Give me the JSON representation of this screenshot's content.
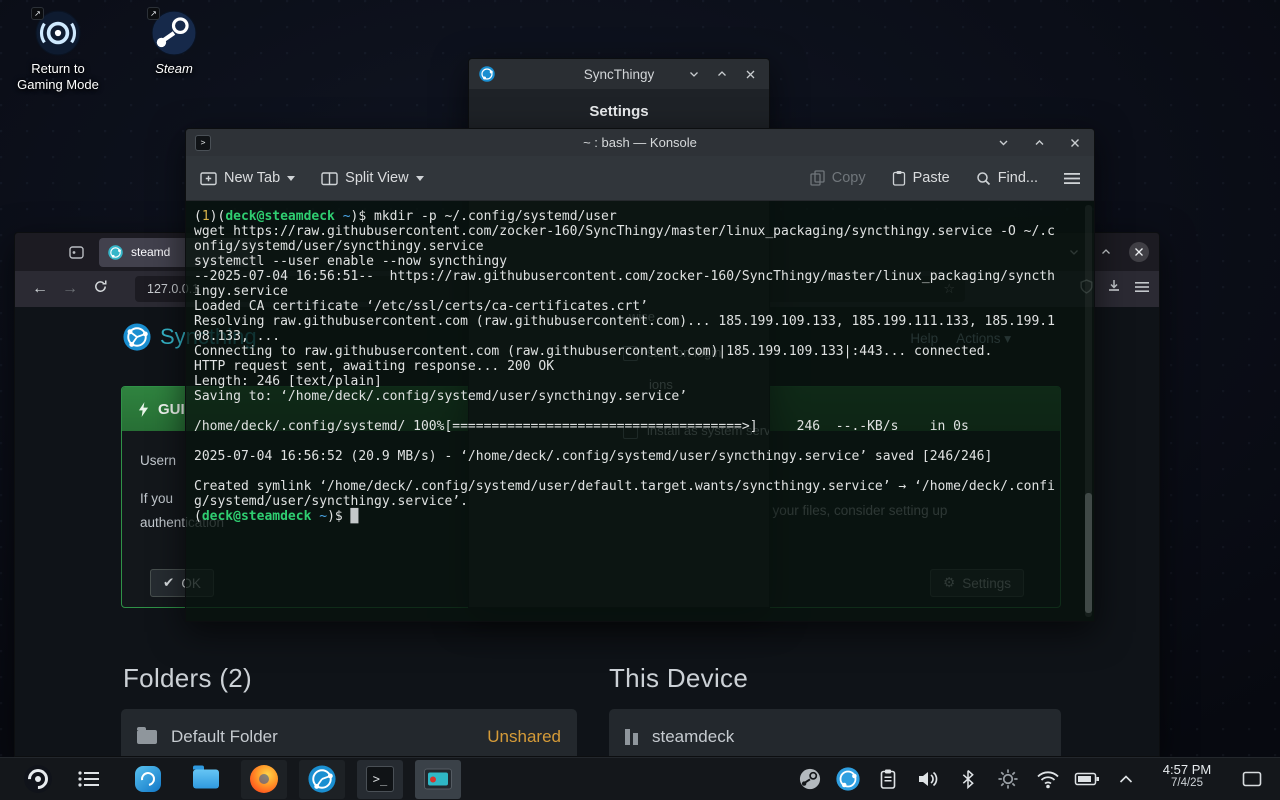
{
  "colors": {
    "kde_accent": "#3daee9",
    "terminal_prompt_green": "#2fce71",
    "terminal_path_cyan": "#4aa6e8",
    "terminal_status_yellow": "#d9b44a",
    "syncthing_teal": "#35b6c9",
    "unshared_orange": "#d59b38",
    "gui_header_green": "#2e7d3c"
  },
  "desktop": {
    "icons": [
      {
        "label": "Return to\nGaming Mode"
      },
      {
        "label": "Steam"
      }
    ]
  },
  "syncthingy": {
    "title": "SyncThingy",
    "settings_header": "Settings",
    "fragments": [
      "wise",
      "start on login",
      "ions",
      "install as system service"
    ]
  },
  "konsole": {
    "title": "~ : bash — Konsole",
    "toolbar": {
      "new_tab": "New Tab",
      "split_view": "Split View",
      "copy": "Copy",
      "paste": "Paste",
      "find": "Find..."
    },
    "terminal": {
      "lines": [
        [
          {
            "t": "(",
            "c": "fg"
          },
          {
            "t": "1",
            "c": "yellow"
          },
          {
            "t": ")(",
            "c": "fg"
          },
          {
            "t": "deck@steamdeck",
            "c": "green"
          },
          {
            "t": " ",
            "c": "fg"
          },
          {
            "t": "~",
            "c": "cyan"
          },
          {
            "t": ")$ ",
            "c": "fg"
          },
          {
            "t": "mkdir -p ~/.config/systemd/user",
            "c": "fg"
          }
        ],
        "wget https://raw.githubusercontent.com/zocker-160/SyncThingy/master/linux_packaging/syncthingy.service -O ~/.c",
        "onfig/systemd/user/syncthingy.service",
        "systemctl --user enable --now syncthingy",
        "--2025-07-04 16:56:51--  https://raw.githubusercontent.com/zocker-160/SyncThingy/master/linux_packaging/syncth",
        "ingy.service",
        "Loaded CA certificate ‘/etc/ssl/certs/ca-certificates.crt’",
        "Resolving raw.githubusercontent.com (raw.githubusercontent.com)... 185.199.109.133, 185.199.111.133, 185.199.1",
        "08.133, ...",
        "Connecting to raw.githubusercontent.com (raw.githubusercontent.com)|185.199.109.133|:443... connected.",
        "HTTP request sent, awaiting response... 200 OK",
        "Length: 246 [text/plain]",
        "Saving to: ‘/home/deck/.config/systemd/user/syncthingy.service’",
        "",
        "/home/deck/.config/systemd/ 100%[=====================================>]     246  --.-KB/s    in 0s",
        "",
        "2025-07-04 16:56:52 (20.9 MB/s) - ‘/home/deck/.config/systemd/user/syncthingy.service’ saved [246/246]",
        "",
        "Created symlink ‘/home/deck/.config/systemd/user/default.target.wants/syncthingy.service’ → ‘/home/deck/.confi",
        "g/systemd/user/syncthingy.service’.",
        [
          {
            "t": "(",
            "c": "fg"
          },
          {
            "t": "deck@steamdeck",
            "c": "green"
          },
          {
            "t": " ",
            "c": "fg"
          },
          {
            "t": "~",
            "c": "cyan"
          },
          {
            "t": ")$ ",
            "c": "fg"
          },
          {
            "t": "█",
            "c": "cursor"
          }
        ]
      ]
    }
  },
  "browser": {
    "tab_label": "steamd",
    "url": "127.0.0.1",
    "page": {
      "brand": "Syncthing",
      "nav_help": "Help",
      "nav_actions": "Actions ▾",
      "gui_panel": {
        "header": "GUI",
        "line1": "Usern",
        "line2": "If you",
        "line2b": "it your files, consider setting up",
        "line3": "authentication",
        "ok_label": "OK",
        "settings_label": "Settings"
      },
      "folders_heading": "Folders (2)",
      "device_heading": "This Device",
      "folder_row": {
        "name": "Default Folder",
        "status": "Unshared"
      },
      "device_row": {
        "name": "steamdeck"
      }
    }
  },
  "taskbar": {
    "clock": {
      "time": "4:57 PM",
      "date": "7/4/25"
    }
  }
}
